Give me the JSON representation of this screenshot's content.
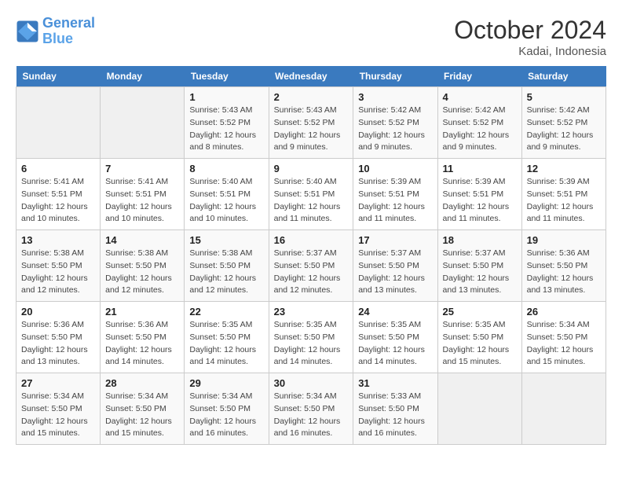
{
  "header": {
    "logo_line1": "General",
    "logo_line2": "Blue",
    "month": "October 2024",
    "location": "Kadai, Indonesia"
  },
  "weekdays": [
    "Sunday",
    "Monday",
    "Tuesday",
    "Wednesday",
    "Thursday",
    "Friday",
    "Saturday"
  ],
  "weeks": [
    [
      {
        "day": "",
        "info": ""
      },
      {
        "day": "",
        "info": ""
      },
      {
        "day": "1",
        "info": "Sunrise: 5:43 AM\nSunset: 5:52 PM\nDaylight: 12 hours and 8 minutes."
      },
      {
        "day": "2",
        "info": "Sunrise: 5:43 AM\nSunset: 5:52 PM\nDaylight: 12 hours and 9 minutes."
      },
      {
        "day": "3",
        "info": "Sunrise: 5:42 AM\nSunset: 5:52 PM\nDaylight: 12 hours and 9 minutes."
      },
      {
        "day": "4",
        "info": "Sunrise: 5:42 AM\nSunset: 5:52 PM\nDaylight: 12 hours and 9 minutes."
      },
      {
        "day": "5",
        "info": "Sunrise: 5:42 AM\nSunset: 5:52 PM\nDaylight: 12 hours and 9 minutes."
      }
    ],
    [
      {
        "day": "6",
        "info": "Sunrise: 5:41 AM\nSunset: 5:51 PM\nDaylight: 12 hours and 10 minutes."
      },
      {
        "day": "7",
        "info": "Sunrise: 5:41 AM\nSunset: 5:51 PM\nDaylight: 12 hours and 10 minutes."
      },
      {
        "day": "8",
        "info": "Sunrise: 5:40 AM\nSunset: 5:51 PM\nDaylight: 12 hours and 10 minutes."
      },
      {
        "day": "9",
        "info": "Sunrise: 5:40 AM\nSunset: 5:51 PM\nDaylight: 12 hours and 11 minutes."
      },
      {
        "day": "10",
        "info": "Sunrise: 5:39 AM\nSunset: 5:51 PM\nDaylight: 12 hours and 11 minutes."
      },
      {
        "day": "11",
        "info": "Sunrise: 5:39 AM\nSunset: 5:51 PM\nDaylight: 12 hours and 11 minutes."
      },
      {
        "day": "12",
        "info": "Sunrise: 5:39 AM\nSunset: 5:51 PM\nDaylight: 12 hours and 11 minutes."
      }
    ],
    [
      {
        "day": "13",
        "info": "Sunrise: 5:38 AM\nSunset: 5:50 PM\nDaylight: 12 hours and 12 minutes."
      },
      {
        "day": "14",
        "info": "Sunrise: 5:38 AM\nSunset: 5:50 PM\nDaylight: 12 hours and 12 minutes."
      },
      {
        "day": "15",
        "info": "Sunrise: 5:38 AM\nSunset: 5:50 PM\nDaylight: 12 hours and 12 minutes."
      },
      {
        "day": "16",
        "info": "Sunrise: 5:37 AM\nSunset: 5:50 PM\nDaylight: 12 hours and 12 minutes."
      },
      {
        "day": "17",
        "info": "Sunrise: 5:37 AM\nSunset: 5:50 PM\nDaylight: 12 hours and 13 minutes."
      },
      {
        "day": "18",
        "info": "Sunrise: 5:37 AM\nSunset: 5:50 PM\nDaylight: 12 hours and 13 minutes."
      },
      {
        "day": "19",
        "info": "Sunrise: 5:36 AM\nSunset: 5:50 PM\nDaylight: 12 hours and 13 minutes."
      }
    ],
    [
      {
        "day": "20",
        "info": "Sunrise: 5:36 AM\nSunset: 5:50 PM\nDaylight: 12 hours and 13 minutes."
      },
      {
        "day": "21",
        "info": "Sunrise: 5:36 AM\nSunset: 5:50 PM\nDaylight: 12 hours and 14 minutes."
      },
      {
        "day": "22",
        "info": "Sunrise: 5:35 AM\nSunset: 5:50 PM\nDaylight: 12 hours and 14 minutes."
      },
      {
        "day": "23",
        "info": "Sunrise: 5:35 AM\nSunset: 5:50 PM\nDaylight: 12 hours and 14 minutes."
      },
      {
        "day": "24",
        "info": "Sunrise: 5:35 AM\nSunset: 5:50 PM\nDaylight: 12 hours and 14 minutes."
      },
      {
        "day": "25",
        "info": "Sunrise: 5:35 AM\nSunset: 5:50 PM\nDaylight: 12 hours and 15 minutes."
      },
      {
        "day": "26",
        "info": "Sunrise: 5:34 AM\nSunset: 5:50 PM\nDaylight: 12 hours and 15 minutes."
      }
    ],
    [
      {
        "day": "27",
        "info": "Sunrise: 5:34 AM\nSunset: 5:50 PM\nDaylight: 12 hours and 15 minutes."
      },
      {
        "day": "28",
        "info": "Sunrise: 5:34 AM\nSunset: 5:50 PM\nDaylight: 12 hours and 15 minutes."
      },
      {
        "day": "29",
        "info": "Sunrise: 5:34 AM\nSunset: 5:50 PM\nDaylight: 12 hours and 16 minutes."
      },
      {
        "day": "30",
        "info": "Sunrise: 5:34 AM\nSunset: 5:50 PM\nDaylight: 12 hours and 16 minutes."
      },
      {
        "day": "31",
        "info": "Sunrise: 5:33 AM\nSunset: 5:50 PM\nDaylight: 12 hours and 16 minutes."
      },
      {
        "day": "",
        "info": ""
      },
      {
        "day": "",
        "info": ""
      }
    ]
  ]
}
